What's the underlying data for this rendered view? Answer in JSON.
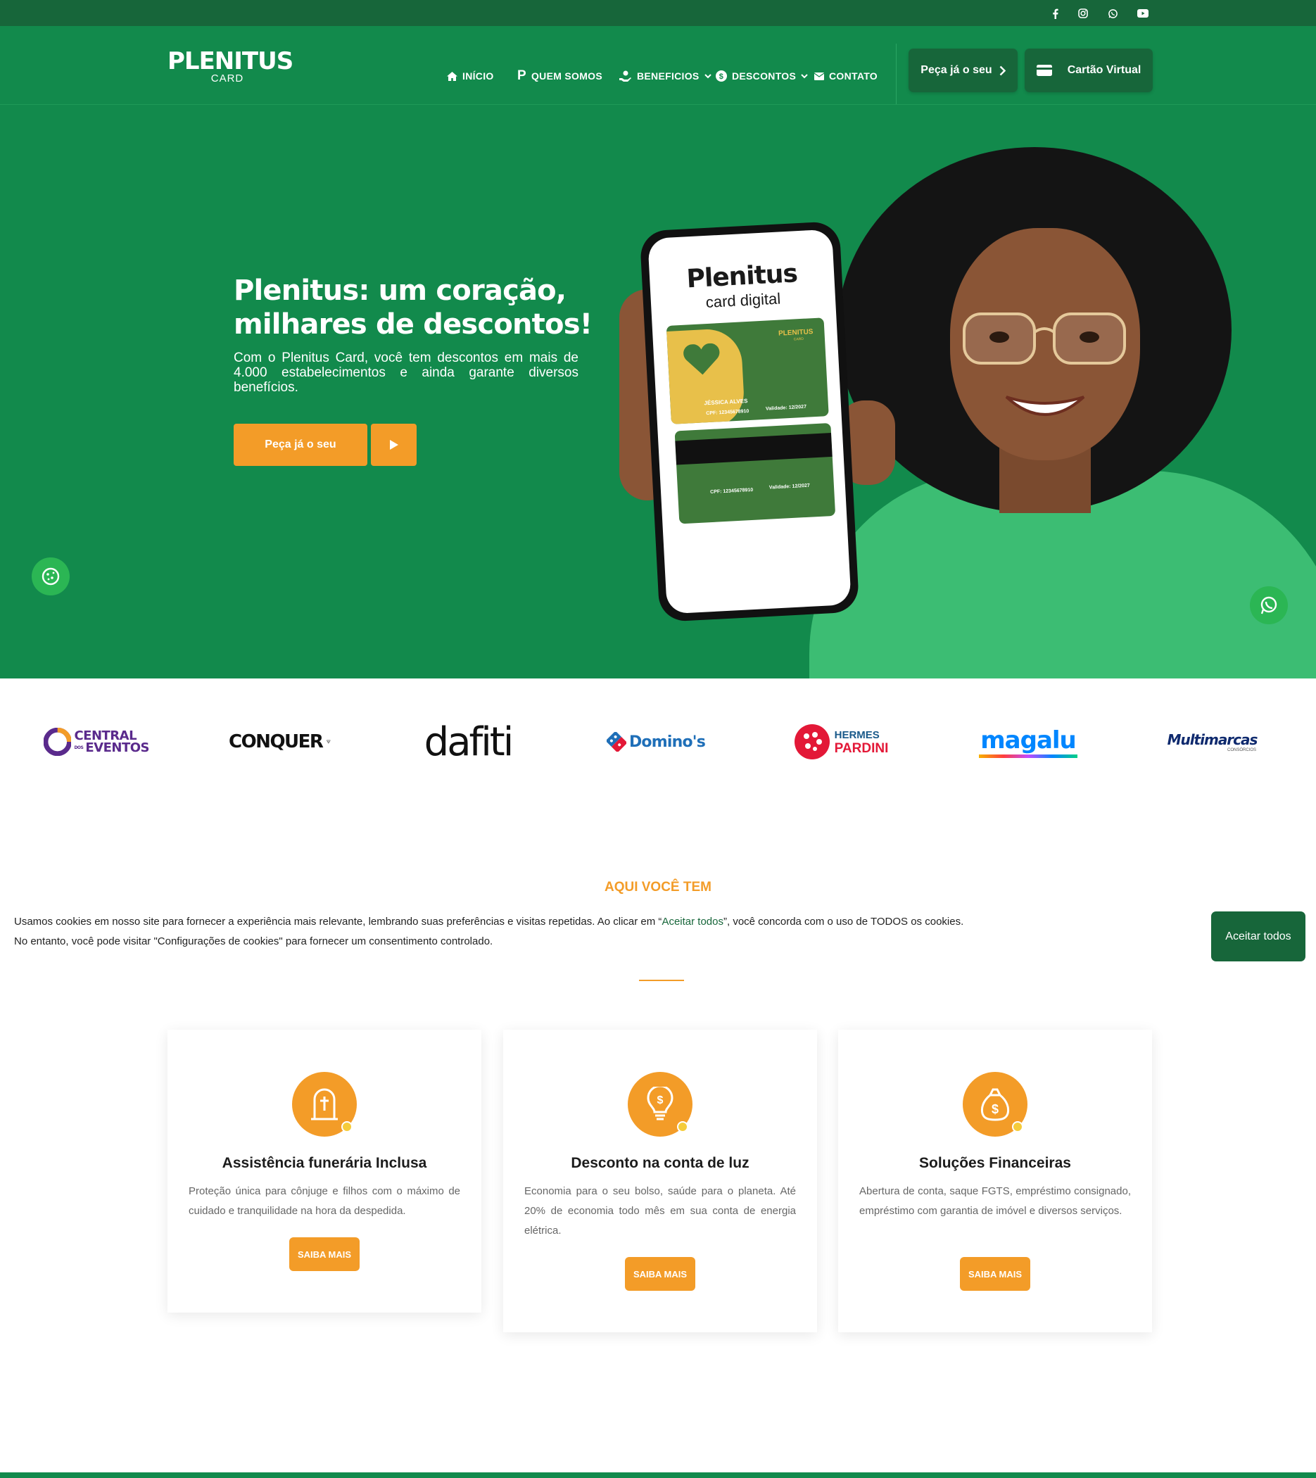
{
  "topbar": {
    "social_icons": [
      "facebook-icon",
      "instagram-icon",
      "whatsapp-icon",
      "youtube-icon"
    ]
  },
  "header": {
    "logo_main": "PLENITUS",
    "logo_sub": "CARD",
    "nav": [
      {
        "label": "INÍCIO",
        "icon": "home-icon"
      },
      {
        "label": "QUEM SOMOS",
        "icon": "p-icon"
      },
      {
        "label": "BENEFICIOS",
        "icon": "hand-heart-icon",
        "dropdown": true
      },
      {
        "label": "DESCONTOS",
        "icon": "dollar-circle-icon",
        "dropdown": true
      },
      {
        "label": "CONTATO",
        "icon": "envelope-icon"
      }
    ],
    "order_button": "Peça já o seu",
    "virtual_card_button": "Cartão Virtual"
  },
  "hero": {
    "title": "Plenitus: um coração, milhares de descontos!",
    "subtitle": "Com o Plenitus Card, você tem descontos em mais de 4.000 estabelecimentos e ainda garante diversos benefícios.",
    "cta_label": "Peça já o seu",
    "phone": {
      "brand": "Plenitus",
      "brand_sub": "card digital",
      "card_brand": "PLENITUS",
      "card_brand_sub": "CARD",
      "holder": "JÉSSICA ALVES",
      "cpf": "CPF: 12345678910",
      "validity": "Validade: 12/2027"
    }
  },
  "partners": [
    "CENTRAL",
    "DOS",
    "EVENTOS",
    "CONQUER",
    "dafiti",
    "Domino's",
    "HERMES",
    "PARDINI",
    "magalu",
    "Multimarcas",
    "CONSÓRCIOS"
  ],
  "benefits": {
    "eyebrow": "AQUI VOCÊ TEM",
    "cards": [
      {
        "title": "Assistência funerária Inclusa",
        "text": "Proteção única para cônjuge e filhos com o máximo de cuidado e tranquilidade na hora da despedida.",
        "button": "SAIBA MAIS",
        "icon": "tombstone-icon"
      },
      {
        "title": "Desconto na conta de luz",
        "text": "Economia para o seu bolso, saúde para o planeta. Até 20% de economia todo mês em sua conta de energia elétrica.",
        "button": "SAIBA MAIS",
        "icon": "lightbulb-dollar-icon"
      },
      {
        "title": "Soluções Financeiras",
        "text": "Abertura de conta, saque FGTS, empréstimo consignado, empréstimo com garantia de imóvel e diversos serviços.",
        "button": "SAIBA MAIS",
        "icon": "money-bag-icon"
      }
    ]
  },
  "cookie": {
    "line1_a": "Usamos cookies em nosso site para fornecer a experiência mais relevante, lembrando suas preferências e visitas repetidas. Ao clicar em “",
    "line1_link": "Aceitar todos",
    "line1_b": "”, você concorda com o uso de TODOS os cookies.",
    "line2": "No entanto, você pode visitar \"Configurações de cookies\" para fornecer um consentimento controlado.",
    "accept": "Aceitar todos"
  },
  "colors": {
    "green": "#128a4c",
    "dark_green": "#17663a",
    "orange": "#f39c28"
  }
}
